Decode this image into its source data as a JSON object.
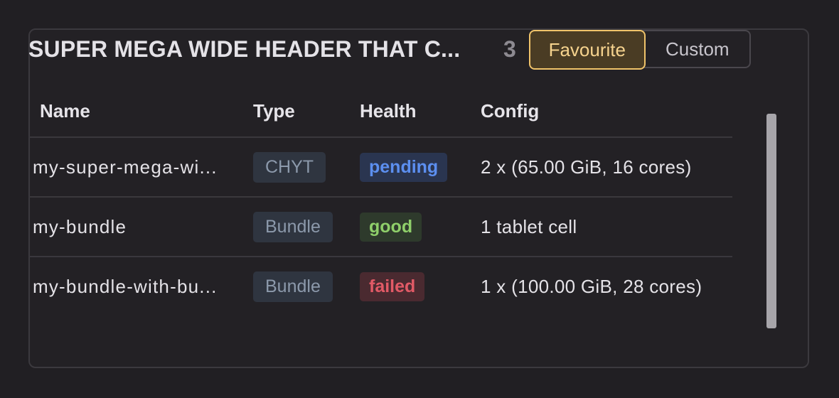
{
  "header": {
    "title": "SUPER MEGA WIDE HEADER THAT C...",
    "count": "3",
    "tabs": [
      {
        "label": "Favourite",
        "active": true
      },
      {
        "label": "Custom",
        "active": false
      }
    ]
  },
  "table": {
    "columns": [
      "Name",
      "Type",
      "Health",
      "Config"
    ],
    "rows": [
      {
        "name": "my-super-mega-wi...",
        "type": "CHYT",
        "health": "pending",
        "config": "2 x (65.00 GiB, 16 cores)"
      },
      {
        "name": "my-bundle",
        "type": "Bundle",
        "health": "good",
        "config": "1 tablet cell"
      },
      {
        "name": "my-bundle-with-bu...",
        "type": "Bundle",
        "health": "failed",
        "config": "1 x (100.00 GiB, 28 cores)"
      }
    ]
  },
  "colors": {
    "accent": "#f0c36a",
    "pending": "#5c8ff0",
    "good": "#8fcf6a",
    "failed": "#e25a66"
  }
}
